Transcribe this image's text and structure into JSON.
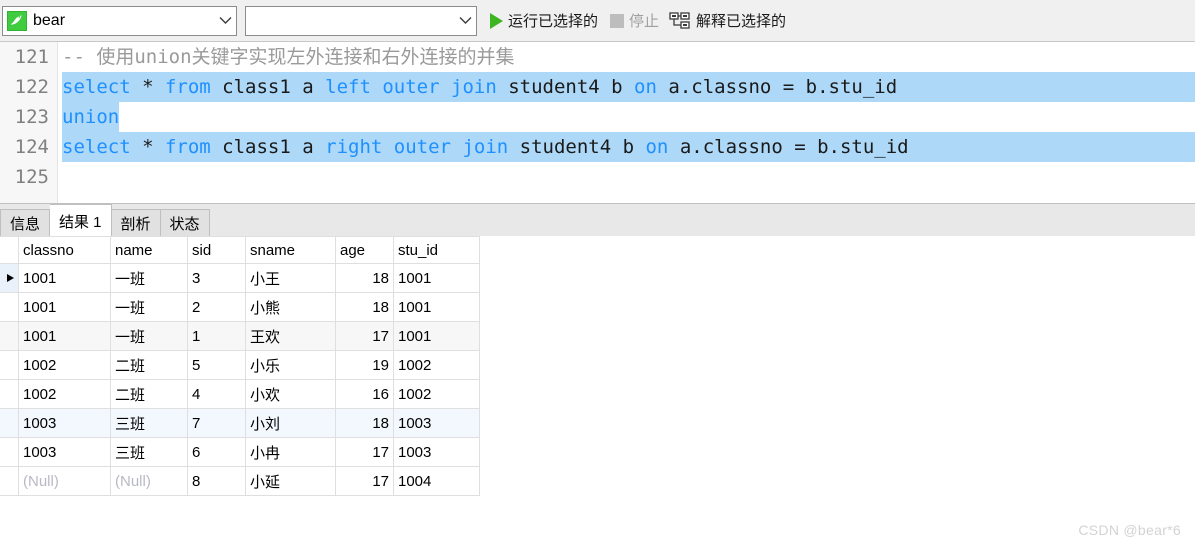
{
  "toolbar": {
    "connection": {
      "value": "bear",
      "icon": "mysql-connection-icon"
    },
    "database": {
      "value": "",
      "placeholder": ""
    },
    "buttons": [
      {
        "label": "运行已选择的",
        "icon": "play-icon",
        "enabled": true
      },
      {
        "label": "停止",
        "icon": "stop-icon",
        "enabled": false
      },
      {
        "label": "解释已选择的",
        "icon": "explain-icon",
        "enabled": true
      }
    ]
  },
  "editor": {
    "lines": [
      {
        "number": "121",
        "selected": false,
        "tokens": [
          {
            "t": "-- 使用union关键字实现左外连接和右外连接的并集",
            "c": "cmt"
          }
        ]
      },
      {
        "number": "122",
        "selected": true,
        "tokens": [
          {
            "t": "select",
            "c": "kw"
          },
          {
            "t": " * ",
            "c": "plain"
          },
          {
            "t": "from",
            "c": "kw"
          },
          {
            "t": " class1 a ",
            "c": "plain"
          },
          {
            "t": "left",
            "c": "kw"
          },
          {
            "t": " ",
            "c": "plain"
          },
          {
            "t": "outer",
            "c": "kw"
          },
          {
            "t": " ",
            "c": "plain"
          },
          {
            "t": "join",
            "c": "kw"
          },
          {
            "t": " student4 b ",
            "c": "plain"
          },
          {
            "t": "on",
            "c": "kw"
          },
          {
            "t": " a.classno = b.stu_id",
            "c": "plain"
          }
        ]
      },
      {
        "number": "123",
        "selected": true,
        "tokens": [
          {
            "t": "union",
            "c": "kw"
          }
        ]
      },
      {
        "number": "124",
        "selected": true,
        "tokens": [
          {
            "t": "select",
            "c": "kw"
          },
          {
            "t": " * ",
            "c": "plain"
          },
          {
            "t": "from",
            "c": "kw"
          },
          {
            "t": " class1 a ",
            "c": "plain"
          },
          {
            "t": "right",
            "c": "kw"
          },
          {
            "t": " ",
            "c": "plain"
          },
          {
            "t": "outer",
            "c": "kw"
          },
          {
            "t": " ",
            "c": "plain"
          },
          {
            "t": "join",
            "c": "kw"
          },
          {
            "t": " student4 b ",
            "c": "plain"
          },
          {
            "t": "on",
            "c": "kw"
          },
          {
            "t": " a.classno = b.stu_id",
            "c": "plain"
          }
        ]
      },
      {
        "number": "125",
        "selected": false,
        "tokens": []
      }
    ],
    "selection_color": "#add8f7",
    "keyword_color": "#1e90ff",
    "comment_color": "#9a9a9a"
  },
  "tabs": [
    {
      "label": "信息",
      "active": false
    },
    {
      "label": "结果 1",
      "active": true
    },
    {
      "label": "剖析",
      "active": false
    },
    {
      "label": "状态",
      "active": false
    }
  ],
  "result_grid": {
    "columns": [
      {
        "key": "classno",
        "label": "classno",
        "selected": true,
        "align": "left"
      },
      {
        "key": "name",
        "label": "name",
        "selected": false,
        "align": "left"
      },
      {
        "key": "sid",
        "label": "sid",
        "selected": false,
        "align": "left"
      },
      {
        "key": "sname",
        "label": "sname",
        "selected": false,
        "align": "left"
      },
      {
        "key": "age",
        "label": "age",
        "selected": false,
        "align": "right"
      },
      {
        "key": "stu_id",
        "label": "stu_id",
        "selected": false,
        "align": "left"
      }
    ],
    "rows": [
      {
        "current": true,
        "tint": "none",
        "classno": "1001",
        "name": "一班",
        "sid": "3",
        "sname": "小王",
        "age": "18",
        "stu_id": "1001"
      },
      {
        "current": false,
        "tint": "none",
        "classno": "1001",
        "name": "一班",
        "sid": "2",
        "sname": "小熊",
        "age": "18",
        "stu_id": "1001"
      },
      {
        "current": false,
        "tint": "gray",
        "classno": "1001",
        "name": "一班",
        "sid": "1",
        "sname": "王欢",
        "age": "17",
        "stu_id": "1001"
      },
      {
        "current": false,
        "tint": "none",
        "classno": "1002",
        "name": "二班",
        "sid": "5",
        "sname": "小乐",
        "age": "19",
        "stu_id": "1002"
      },
      {
        "current": false,
        "tint": "none",
        "classno": "1002",
        "name": "二班",
        "sid": "4",
        "sname": "小欢",
        "age": "16",
        "stu_id": "1002"
      },
      {
        "current": false,
        "tint": "blue",
        "classno": "1003",
        "name": "三班",
        "sid": "7",
        "sname": "小刘",
        "age": "18",
        "stu_id": "1003"
      },
      {
        "current": false,
        "tint": "none",
        "classno": "1003",
        "name": "三班",
        "sid": "6",
        "sname": "小冉",
        "age": "17",
        "stu_id": "1003"
      },
      {
        "current": false,
        "tint": "none",
        "classno": "(Null)",
        "name": "(Null)",
        "sid": "8",
        "sname": "小延",
        "age": "17",
        "stu_id": "1004",
        "null_cols": [
          "classno",
          "name"
        ]
      }
    ],
    "header_selected_color": "#ddeaf7",
    "null_text_color": "#b9b9c4"
  },
  "watermark": {
    "text": "CSDN @bear*6"
  }
}
